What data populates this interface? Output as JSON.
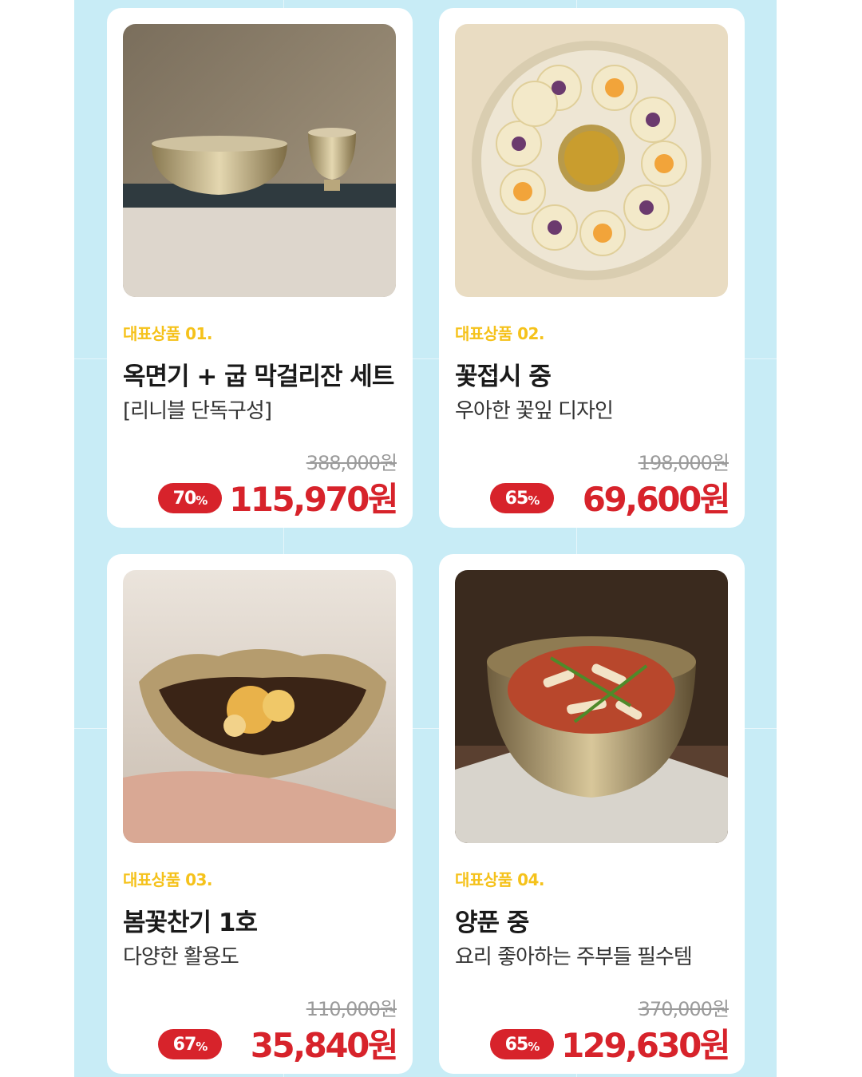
{
  "colors": {
    "panel_bg": "#c8ecf6",
    "tag_yellow": "#f5c21b",
    "sale_red": "#d7232b",
    "original_gray": "#9a9a9a"
  },
  "products": [
    {
      "tag": "대표상품 01.",
      "name": "옥면기 + 굽 막걸리잔 세트",
      "subtitle": "[리니블 단독구성]",
      "original_price": "388,000원",
      "discount": "70",
      "discount_unit": "%",
      "price": "115,970원",
      "photo_icon": "brass-bowl-and-cup-photo"
    },
    {
      "tag": "대표상품 02.",
      "name": "꽃접시 중",
      "subtitle": "우아한 꽃잎 디자인",
      "original_price": "198,000원",
      "discount": "65",
      "discount_unit": "%",
      "price": "69,600원",
      "photo_icon": "flower-plate-photo"
    },
    {
      "tag": "대표상품 03.",
      "name": "봄꽃찬기 1호",
      "subtitle": "다양한 활용도",
      "original_price": "110,000원",
      "discount": "67",
      "discount_unit": "%",
      "price": "35,840원",
      "photo_icon": "side-dish-bowl-photo"
    },
    {
      "tag": "대표상품 04.",
      "name": "양푼 중",
      "subtitle": "요리 좋아하는 주부들 필수템",
      "original_price": "370,000원",
      "discount": "65",
      "discount_unit": "%",
      "price": "129,630원",
      "photo_icon": "kimchi-bowl-photo"
    }
  ]
}
